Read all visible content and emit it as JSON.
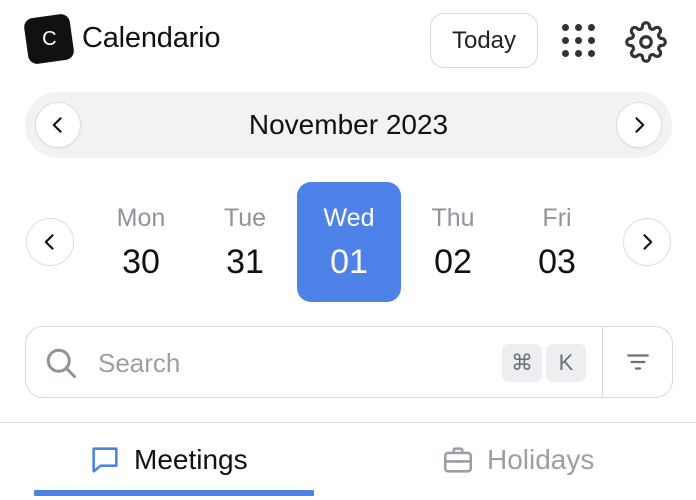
{
  "header": {
    "logo_letter": "C",
    "app_title": "Calendario",
    "today_label": "Today",
    "apps_icon": "grid-dots-icon",
    "settings_icon": "gear-icon"
  },
  "month_nav": {
    "label": "November 2023",
    "prev_icon": "chevron-left-icon",
    "next_icon": "chevron-right-icon"
  },
  "days": [
    {
      "name": "Mon",
      "date": "30",
      "selected": false
    },
    {
      "name": "Tue",
      "date": "31",
      "selected": false
    },
    {
      "name": "Wed",
      "date": "01",
      "selected": true
    },
    {
      "name": "Thu",
      "date": "02",
      "selected": false
    },
    {
      "name": "Fri",
      "date": "03",
      "selected": false
    }
  ],
  "search": {
    "placeholder": "Search",
    "value": "",
    "shortcut_keys": [
      "⌘",
      "K"
    ],
    "filter_icon": "filter-icon"
  },
  "tabs": [
    {
      "label": "Meetings",
      "icon": "message-square-icon",
      "active": true
    },
    {
      "label": "Holidays",
      "icon": "briefcase-icon",
      "active": false
    }
  ],
  "colors": {
    "accent": "#4f82e8",
    "text": "#111111",
    "muted": "#9a9ea6",
    "border": "#d7d9de",
    "month_bar_bg": "#f1f2f4"
  }
}
